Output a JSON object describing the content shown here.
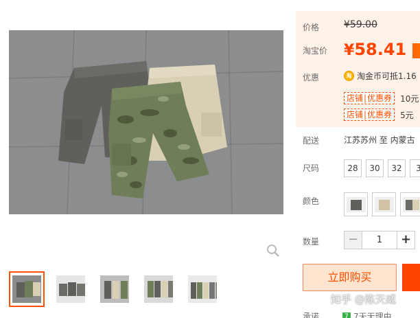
{
  "price": {
    "label": "价格",
    "original": "¥59.00"
  },
  "taobao_price": {
    "label": "淘宝价",
    "currency": "¥",
    "value": "58.41"
  },
  "promo": {
    "label": "优惠",
    "coin_icon_char": "淘",
    "coin_text": "淘金币可抵1.16",
    "coupons": [
      {
        "badge_left": "店铺",
        "badge_right": "优惠券",
        "text": "10元"
      },
      {
        "badge_left": "店铺",
        "badge_right": "优惠券",
        "text": "5元"
      }
    ]
  },
  "shipping": {
    "label": "配送",
    "text": "江苏苏州 至  内蒙古"
  },
  "size": {
    "label": "尺码",
    "options": [
      "28",
      "30",
      "32",
      "3"
    ]
  },
  "color": {
    "label": "颜色",
    "swatches": [
      "grey-shorts",
      "khaki-shorts",
      "grey-khaki-shorts"
    ]
  },
  "quantity": {
    "label": "数量",
    "minus": "−",
    "value": "1",
    "plus": "+"
  },
  "actions": {
    "buy_now": "立即购买"
  },
  "watermark": "知乎 @陈天威",
  "bottom": {
    "label": "承诺",
    "mark": "7",
    "text": "7天无理由"
  },
  "colors": {
    "accent": "#ff4400",
    "panel_bg": "#fff2e8",
    "thumb_active": "#ff5000"
  }
}
